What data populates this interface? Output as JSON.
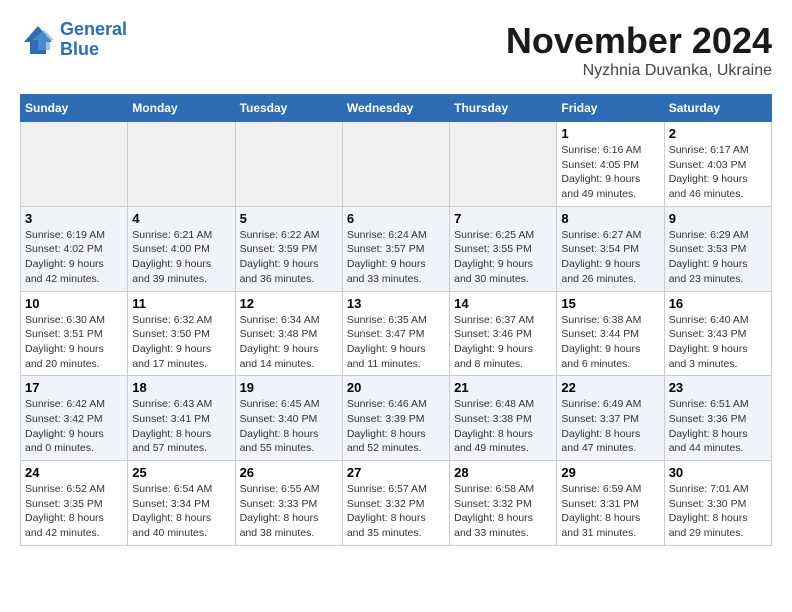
{
  "header": {
    "logo_line1": "General",
    "logo_line2": "Blue",
    "month": "November 2024",
    "location": "Nyzhnia Duvanka, Ukraine"
  },
  "weekdays": [
    "Sunday",
    "Monday",
    "Tuesday",
    "Wednesday",
    "Thursday",
    "Friday",
    "Saturday"
  ],
  "weeks": [
    [
      {
        "day": "",
        "info": ""
      },
      {
        "day": "",
        "info": ""
      },
      {
        "day": "",
        "info": ""
      },
      {
        "day": "",
        "info": ""
      },
      {
        "day": "",
        "info": ""
      },
      {
        "day": "1",
        "info": "Sunrise: 6:16 AM\nSunset: 4:05 PM\nDaylight: 9 hours and 49 minutes."
      },
      {
        "day": "2",
        "info": "Sunrise: 6:17 AM\nSunset: 4:03 PM\nDaylight: 9 hours and 46 minutes."
      }
    ],
    [
      {
        "day": "3",
        "info": "Sunrise: 6:19 AM\nSunset: 4:02 PM\nDaylight: 9 hours and 42 minutes."
      },
      {
        "day": "4",
        "info": "Sunrise: 6:21 AM\nSunset: 4:00 PM\nDaylight: 9 hours and 39 minutes."
      },
      {
        "day": "5",
        "info": "Sunrise: 6:22 AM\nSunset: 3:59 PM\nDaylight: 9 hours and 36 minutes."
      },
      {
        "day": "6",
        "info": "Sunrise: 6:24 AM\nSunset: 3:57 PM\nDaylight: 9 hours and 33 minutes."
      },
      {
        "day": "7",
        "info": "Sunrise: 6:25 AM\nSunset: 3:55 PM\nDaylight: 9 hours and 30 minutes."
      },
      {
        "day": "8",
        "info": "Sunrise: 6:27 AM\nSunset: 3:54 PM\nDaylight: 9 hours and 26 minutes."
      },
      {
        "day": "9",
        "info": "Sunrise: 6:29 AM\nSunset: 3:53 PM\nDaylight: 9 hours and 23 minutes."
      }
    ],
    [
      {
        "day": "10",
        "info": "Sunrise: 6:30 AM\nSunset: 3:51 PM\nDaylight: 9 hours and 20 minutes."
      },
      {
        "day": "11",
        "info": "Sunrise: 6:32 AM\nSunset: 3:50 PM\nDaylight: 9 hours and 17 minutes."
      },
      {
        "day": "12",
        "info": "Sunrise: 6:34 AM\nSunset: 3:48 PM\nDaylight: 9 hours and 14 minutes."
      },
      {
        "day": "13",
        "info": "Sunrise: 6:35 AM\nSunset: 3:47 PM\nDaylight: 9 hours and 11 minutes."
      },
      {
        "day": "14",
        "info": "Sunrise: 6:37 AM\nSunset: 3:46 PM\nDaylight: 9 hours and 8 minutes."
      },
      {
        "day": "15",
        "info": "Sunrise: 6:38 AM\nSunset: 3:44 PM\nDaylight: 9 hours and 6 minutes."
      },
      {
        "day": "16",
        "info": "Sunrise: 6:40 AM\nSunset: 3:43 PM\nDaylight: 9 hours and 3 minutes."
      }
    ],
    [
      {
        "day": "17",
        "info": "Sunrise: 6:42 AM\nSunset: 3:42 PM\nDaylight: 9 hours and 0 minutes."
      },
      {
        "day": "18",
        "info": "Sunrise: 6:43 AM\nSunset: 3:41 PM\nDaylight: 8 hours and 57 minutes."
      },
      {
        "day": "19",
        "info": "Sunrise: 6:45 AM\nSunset: 3:40 PM\nDaylight: 8 hours and 55 minutes."
      },
      {
        "day": "20",
        "info": "Sunrise: 6:46 AM\nSunset: 3:39 PM\nDaylight: 8 hours and 52 minutes."
      },
      {
        "day": "21",
        "info": "Sunrise: 6:48 AM\nSunset: 3:38 PM\nDaylight: 8 hours and 49 minutes."
      },
      {
        "day": "22",
        "info": "Sunrise: 6:49 AM\nSunset: 3:37 PM\nDaylight: 8 hours and 47 minutes."
      },
      {
        "day": "23",
        "info": "Sunrise: 6:51 AM\nSunset: 3:36 PM\nDaylight: 8 hours and 44 minutes."
      }
    ],
    [
      {
        "day": "24",
        "info": "Sunrise: 6:52 AM\nSunset: 3:35 PM\nDaylight: 8 hours and 42 minutes."
      },
      {
        "day": "25",
        "info": "Sunrise: 6:54 AM\nSunset: 3:34 PM\nDaylight: 8 hours and 40 minutes."
      },
      {
        "day": "26",
        "info": "Sunrise: 6:55 AM\nSunset: 3:33 PM\nDaylight: 8 hours and 38 minutes."
      },
      {
        "day": "27",
        "info": "Sunrise: 6:57 AM\nSunset: 3:32 PM\nDaylight: 8 hours and 35 minutes."
      },
      {
        "day": "28",
        "info": "Sunrise: 6:58 AM\nSunset: 3:32 PM\nDaylight: 8 hours and 33 minutes."
      },
      {
        "day": "29",
        "info": "Sunrise: 6:59 AM\nSunset: 3:31 PM\nDaylight: 8 hours and 31 minutes."
      },
      {
        "day": "30",
        "info": "Sunrise: 7:01 AM\nSunset: 3:30 PM\nDaylight: 8 hours and 29 minutes."
      }
    ]
  ]
}
